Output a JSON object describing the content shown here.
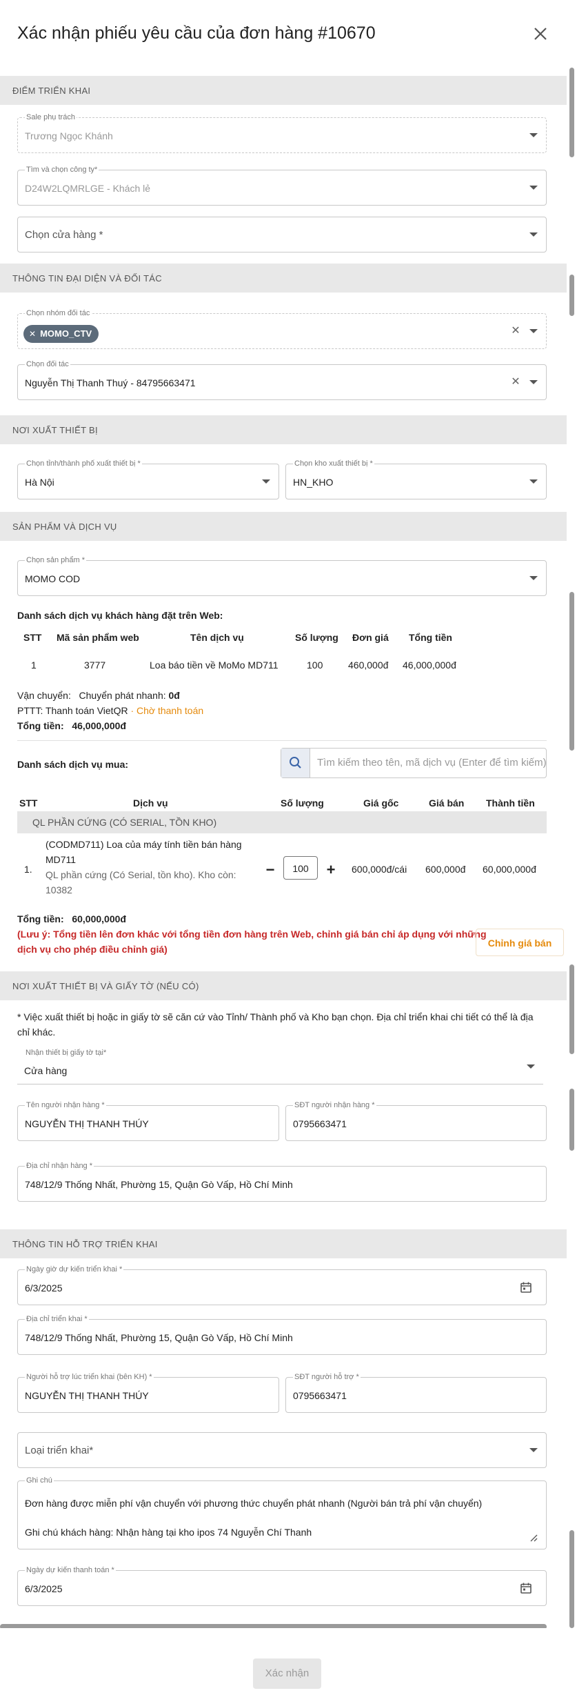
{
  "dialog": {
    "title": "Xác nhận phiếu yêu cầu của đơn hàng #10670",
    "submit_label": "Xác nhận"
  },
  "sections": {
    "deploy_point": "ĐIỂM TRIỂN KHAI",
    "partner_info": "THÔNG TIN ĐẠI DIỆN VÀ ĐỐI TÁC",
    "export_place": "NƠI XUẤT THIẾT BỊ",
    "products": "SẢN PHẨM VÀ DỊCH VỤ",
    "export_docs": "NƠI XUẤT THIẾT BỊ VÀ GIẤY TỜ (NẾU CÓ)",
    "support_info": "THÔNG TIN HỖ TRỢ TRIỂN KHAI"
  },
  "deploy_point": {
    "sale_label": "Sale phụ trách",
    "sale_value": "Trương Ngọc Khánh",
    "company_label": "Tìm và chọn công ty*",
    "company_value": "D24W2LQMRLGE - Khách lẻ",
    "store_placeholder": "Chọn cửa hàng *"
  },
  "partner_info": {
    "partner_group_label": "Chọn nhóm đối tác",
    "partner_group_chip": "MOMO_CTV",
    "partner_label": "Chọn đối tác",
    "partner_value": "Nguyễn Thị Thanh Thuý - 84795663471"
  },
  "export_place": {
    "city_label": "Chọn tỉnh/thành phố xuất thiết bị *",
    "city_value": "Hà Nội",
    "warehouse_label": "Chọn kho xuất thiết bị *",
    "warehouse_value": "HN_KHO"
  },
  "products": {
    "product_label": "Chọn sản phẩm *",
    "product_value": "MOMO COD",
    "web_list_title": "Danh sách dịch vụ khách hàng đặt trên Web:",
    "web_headers": [
      "STT",
      "Mã sản phẩm web",
      "Tên dịch vụ",
      "Số lượng",
      "Đơn giá",
      "Tổng tiền"
    ],
    "web_rows": [
      {
        "stt": "1",
        "code": "3777",
        "name": "Loa báo tiền về MoMo MD711",
        "qty": "100",
        "price": "460,000đ",
        "total": "46,000,000đ"
      }
    ],
    "shipping_label": "Vận chuyển:",
    "shipping_method": "Chuyển phát nhanh:",
    "shipping_fee": "0đ",
    "payment_label": "PTTT: Thanh toán VietQR",
    "payment_status": "· Chờ thanh toán",
    "web_total_label": "Tổng tiền:",
    "web_total_value": "46,000,000đ",
    "buy_list_title": "Danh sách dịch vụ mua:",
    "search_placeholder": "Tìm kiếm theo tên, mã dịch vụ (Enter để tìm kiếm)",
    "buy_headers": [
      "STT",
      "Dịch vụ",
      "Số lượng",
      "Giá gốc",
      "Giá bán",
      "Thành tiền"
    ],
    "group_name": "QL PHẦN CỨNG (CÓ SERIAL, TỒN KHO)",
    "buy_rows": [
      {
        "stt": "1.",
        "name_line1": "(CODMD711) Loa của máy tính tiền bán hàng",
        "name_line2": "MD711",
        "desc_line1": "QL phần cứng (Có Serial, tồn kho). Kho còn:",
        "desc_line2": "10382",
        "qty": "100",
        "base_price": "600,000đ/cái",
        "sale_price": "600,000đ",
        "total": "60,000,000đ"
      }
    ],
    "buy_total_label": "Tổng tiền:",
    "buy_total_value": "60,000,000đ",
    "note_line1": "(Lưu ý: Tổng tiền lên đơn khác với tổng tiền đơn hàng trên Web, chỉnh giá bán chỉ áp dụng với những",
    "note_line2": "dịch vụ cho phép điều chỉnh giá)",
    "adjust_button": "Chỉnh giá bán"
  },
  "export_docs": {
    "info_line1": "* Việc xuất thiết bị hoặc in giấy tờ sẽ căn cứ vào Tỉnh/ Thành phố và Kho bạn chọn. Địa chỉ triển khai chi tiết có thể là địa",
    "info_line2": "chỉ khác.",
    "receive_label": "Nhận thiết bị giấy tờ tại*",
    "receive_value": "Cửa hàng",
    "receiver_name_label": "Tên người nhận hàng *",
    "receiver_name_value": "NGUYỄN THỊ THANH THÚY",
    "receiver_phone_label": "SĐT người nhận hàng *",
    "receiver_phone_value": "0795663471",
    "receive_address_label": "Địa chỉ nhận hàng *",
    "receive_address_value": "748/12/9 Thống Nhất, Phường 15, Quận Gò Vấp, Hồ Chí Minh"
  },
  "support_info": {
    "expected_time_label": "Ngày giờ dự kiến triển khai *",
    "expected_time_value": "6/3/2025",
    "deploy_address_label": "Địa chỉ triển khai *",
    "deploy_address_value": "748/12/9 Thống Nhất, Phường 15, Quận Gò Vấp, Hồ Chí Minh",
    "support_person_label": "Người hỗ trợ lúc triển khai (bên KH) *",
    "support_person_value": "NGUYỄN THỊ THANH THÚY",
    "support_phone_label": "SĐT người hỗ trợ *",
    "support_phone_value": "0795663471",
    "deploy_type_placeholder": "Loại triển khai*",
    "note_label": "Ghi chú",
    "note_line1": "Đơn hàng được miễn phí vận chuyển với phương thức chuyển phát nhanh (Người bán trả phí vận chuyển)",
    "note_line2": "Ghi chú khách hàng: Nhận hàng tại kho ipos 74 Nguyễn Chí Thanh",
    "payment_date_label": "Ngày dự kiến thanh toán *",
    "payment_date_value": "6/3/2025"
  }
}
